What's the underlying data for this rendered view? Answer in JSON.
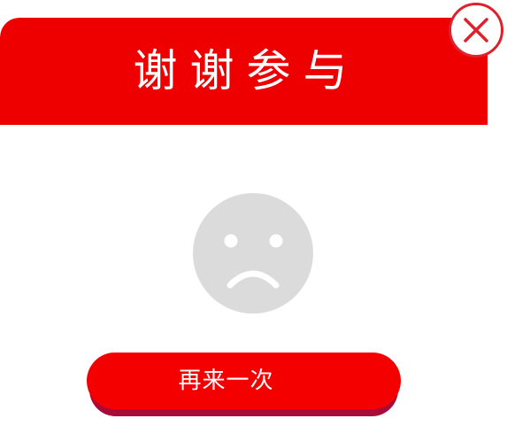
{
  "dialog": {
    "title": "谢谢参与",
    "face_icon": "sad-face-icon",
    "close_icon": "close-icon",
    "retry_label": "再来一次"
  },
  "colors": {
    "header": "#ef0000",
    "close_ring": "#e0202d",
    "face": "#dcdbdc",
    "button": "#f40000",
    "button_shadow": "#a90a3a"
  }
}
